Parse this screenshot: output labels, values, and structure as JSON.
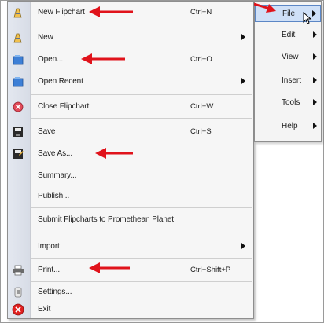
{
  "file_menu": {
    "items": [
      {
        "label": "New Flipchart",
        "shortcut": "Ctrl+N",
        "icon": "new-flipchart-icon"
      },
      {
        "label": "New",
        "submenu": true,
        "icon": "new-icon"
      },
      {
        "label": "Open...",
        "shortcut": "Ctrl+O",
        "icon": "open-icon"
      },
      {
        "label": "Open Recent",
        "submenu": true,
        "icon": "open-recent-icon"
      },
      {
        "label": "Close Flipchart",
        "shortcut": "Ctrl+W",
        "icon": "close-flipchart-icon"
      },
      {
        "label": "Save",
        "shortcut": "Ctrl+S",
        "icon": "save-icon"
      },
      {
        "label": "Save As...",
        "icon": "save-as-icon"
      },
      {
        "label": "Summary..."
      },
      {
        "label": "Publish..."
      },
      {
        "label": "Submit Flipcharts to Promethean Planet"
      },
      {
        "label": "Import",
        "submenu": true
      },
      {
        "label": "Print...",
        "shortcut": "Ctrl+Shift+P",
        "icon": "printer-icon"
      },
      {
        "label": "Settings...",
        "icon": "settings-icon"
      },
      {
        "label": "Exit",
        "icon": "exit-icon"
      }
    ]
  },
  "menu_bar": {
    "items": [
      {
        "label": "File"
      },
      {
        "label": "Edit"
      },
      {
        "label": "View"
      },
      {
        "label": "Insert"
      },
      {
        "label": "Tools"
      },
      {
        "label": "Help"
      }
    ]
  },
  "colors": {
    "annotation_arrow": "#e0131b",
    "highlight": "#cfe0f7",
    "highlight_border": "#5b86c5"
  }
}
